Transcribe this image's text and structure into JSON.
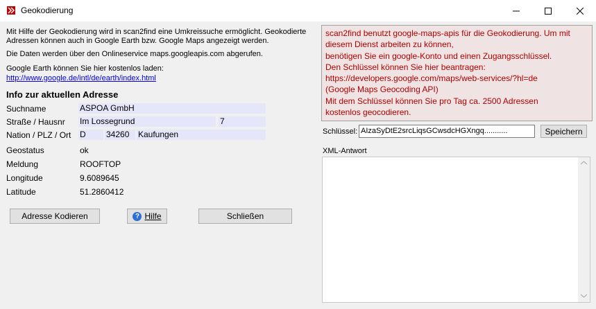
{
  "window": {
    "title": "Geokodierung",
    "minimize_glyph": "—",
    "maximize_glyph": "☐",
    "close_glyph": "✕"
  },
  "intro": {
    "line1": "Mit Hilfe der Geokodierung wird in scan2find eine Umkreissuche  ermöglicht. Geokodierte",
    "line2": "Adressen können auch in Google Earth bzw. Google Maps angezeigt werden.",
    "line3": "Die Daten werden über den Onlineservice maps.googleapis.com abgerufen.",
    "line4": "Google Earth können Sie hier kostenlos laden:",
    "link": "http://www.google.de/intl/de/earth/index.html"
  },
  "address": {
    "heading": "Info zur aktuellen Adresse",
    "labels": {
      "name": "Suchname",
      "street": "Straße / Hausnr",
      "nation": "Nation / PLZ / Ort",
      "status": "Geostatus",
      "message": "Meldung",
      "longitude": "Longitude",
      "latitude": "Latitude"
    },
    "values": {
      "name": "ASPOA GmbH",
      "street": "Im Lossegrund",
      "house_no": "7",
      "nation": "D",
      "zip": "34260",
      "city": "Kaufungen",
      "status": "ok",
      "message": "ROOFTOP",
      "longitude": "9.6089645",
      "latitude": "51.2860412"
    }
  },
  "buttons": {
    "encode": "Adresse Kodieren",
    "help": "Hilfe",
    "close": "Schließen",
    "save": "Speichern"
  },
  "info_box": {
    "lines": [
      "scan2find benutzt google-maps-apis für die Geokodierung. Um mit",
      "diesem Dienst arbeiten zu können,",
      "benötigen Sie ein google-Konto und einen Zugangsschlüssel.",
      "Den Schlüssel können Sie hier beantragen:",
      "https://developers.google.com/maps/web-services/?hl=de",
      "(Google Maps Geocoding API)",
      "Mit dem Schlüssel können Sie pro Tag ca. 2500 Adressen",
      "kostenlos geocodieren."
    ]
  },
  "key": {
    "label": "Schlüssel:",
    "value": "AIzaSyDtE2srcLiqsGCwsdcHGXngq..........."
  },
  "xml": {
    "label": "XML-Antwort",
    "content": ""
  },
  "colors": {
    "info_text": "#b00000",
    "info_bg": "#efe3e3",
    "field_bg": "#e6e6fa",
    "link": "#0000ee"
  }
}
